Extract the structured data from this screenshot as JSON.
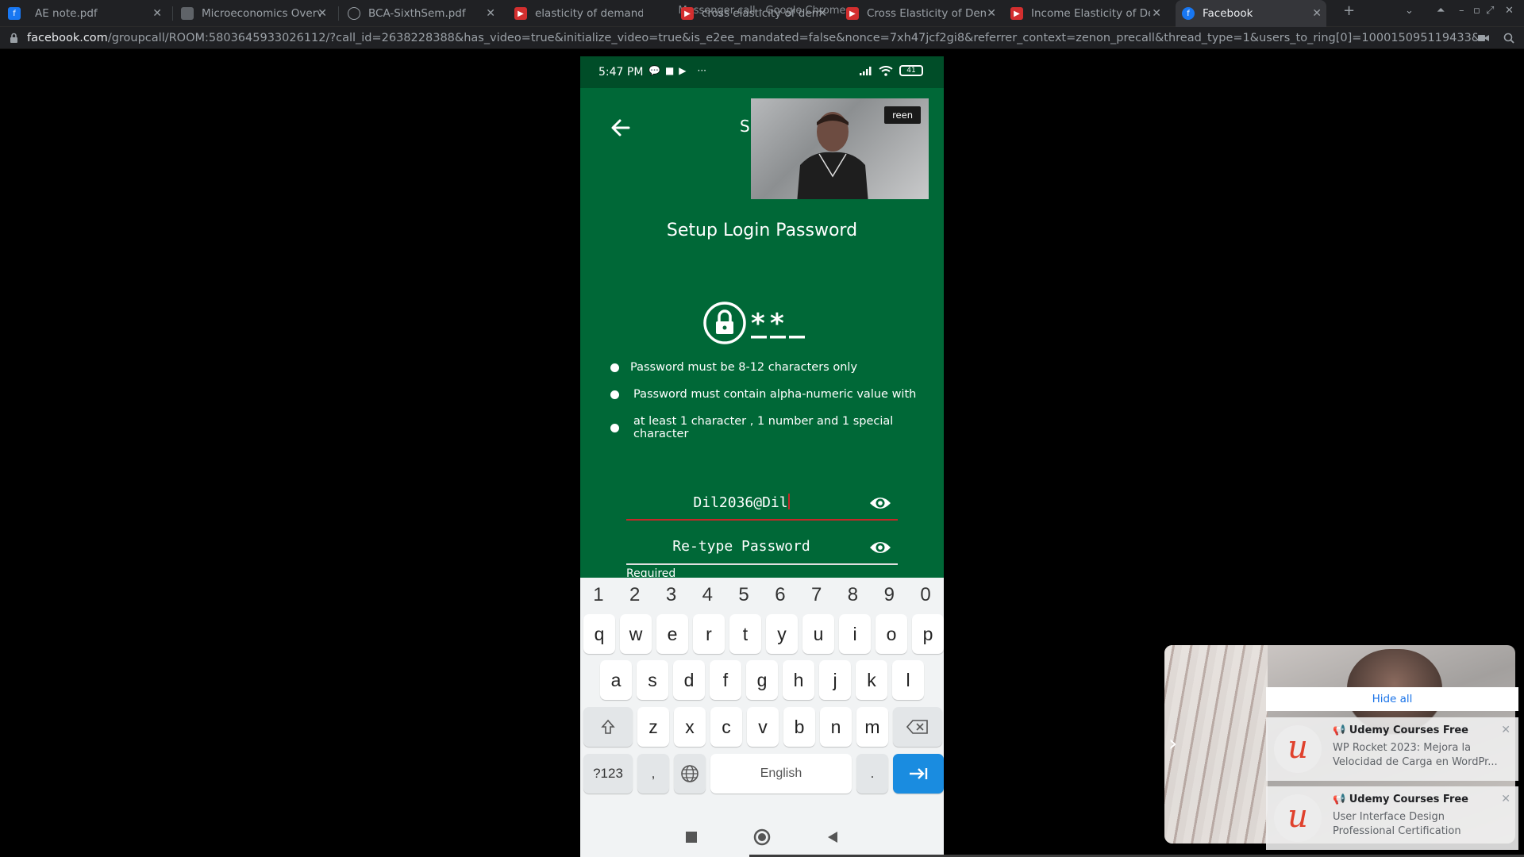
{
  "window": {
    "title": "Messenger call - Google Chrome",
    "tabs": [
      {
        "title": "AE note.pdf"
      },
      {
        "title": "Microeconomics Overvi"
      },
      {
        "title": "BCA-SixthSem.pdf"
      },
      {
        "title": "elasticity of demand an"
      },
      {
        "title": "cross elasticity of dema"
      },
      {
        "title": "Cross Elasticity of Dema"
      },
      {
        "title": "Income Elasticity of Den"
      },
      {
        "title": "Facebook"
      }
    ],
    "new_tab": "+",
    "url_host": "facebook.com",
    "url_path": "/groupcall/ROOM:5803645933026112/?call_id=2638228388&has_video=true&initialize_video=true&is_e2ee_mandated=false&nonce=7xh47jcf2gi8&referrer_context=zenon_precall&thread_type=1&users_to_ring[0]=100015095119433&use_joining_context=tru..."
  },
  "phone": {
    "status_time": "5:47 PM",
    "status_more": "···",
    "battery": "41",
    "title_fragment": "S",
    "pip_badge": "reen",
    "heading": "Setup Login Password",
    "rules": [
      "Password must be 8-12 characters only",
      "Password must contain alpha-numeric value with",
      "at least 1 character , 1 number and 1 special character"
    ],
    "password_value": "Dil2036@Dil",
    "retype_placeholder": "Re-type Password",
    "required_label": "Required",
    "keyboard": {
      "numbers": [
        "1",
        "2",
        "3",
        "4",
        "5",
        "6",
        "7",
        "8",
        "9",
        "0"
      ],
      "row1": [
        "q",
        "w",
        "e",
        "r",
        "t",
        "y",
        "u",
        "i",
        "o",
        "p"
      ],
      "row2": [
        "a",
        "s",
        "d",
        "f",
        "g",
        "h",
        "j",
        "k",
        "l"
      ],
      "row3": [
        "z",
        "x",
        "c",
        "v",
        "b",
        "n",
        "m"
      ],
      "symbols_key": "?123",
      "comma_key": ",",
      "space_label": "English",
      "period_key": "."
    }
  },
  "notifications": {
    "hide_all": "Hide all",
    "items": [
      {
        "app": "Udemy Courses Free",
        "body": "WP Rocket 2023: Mejora la Velocidad de Carga en WordPr..."
      },
      {
        "app": "Udemy Courses Free",
        "body": "User Interface Design Professional Certification"
      }
    ]
  },
  "colors": {
    "app_green": "#006837",
    "field_underline_active": "#c62828",
    "enter_key": "#1a8ce0"
  }
}
